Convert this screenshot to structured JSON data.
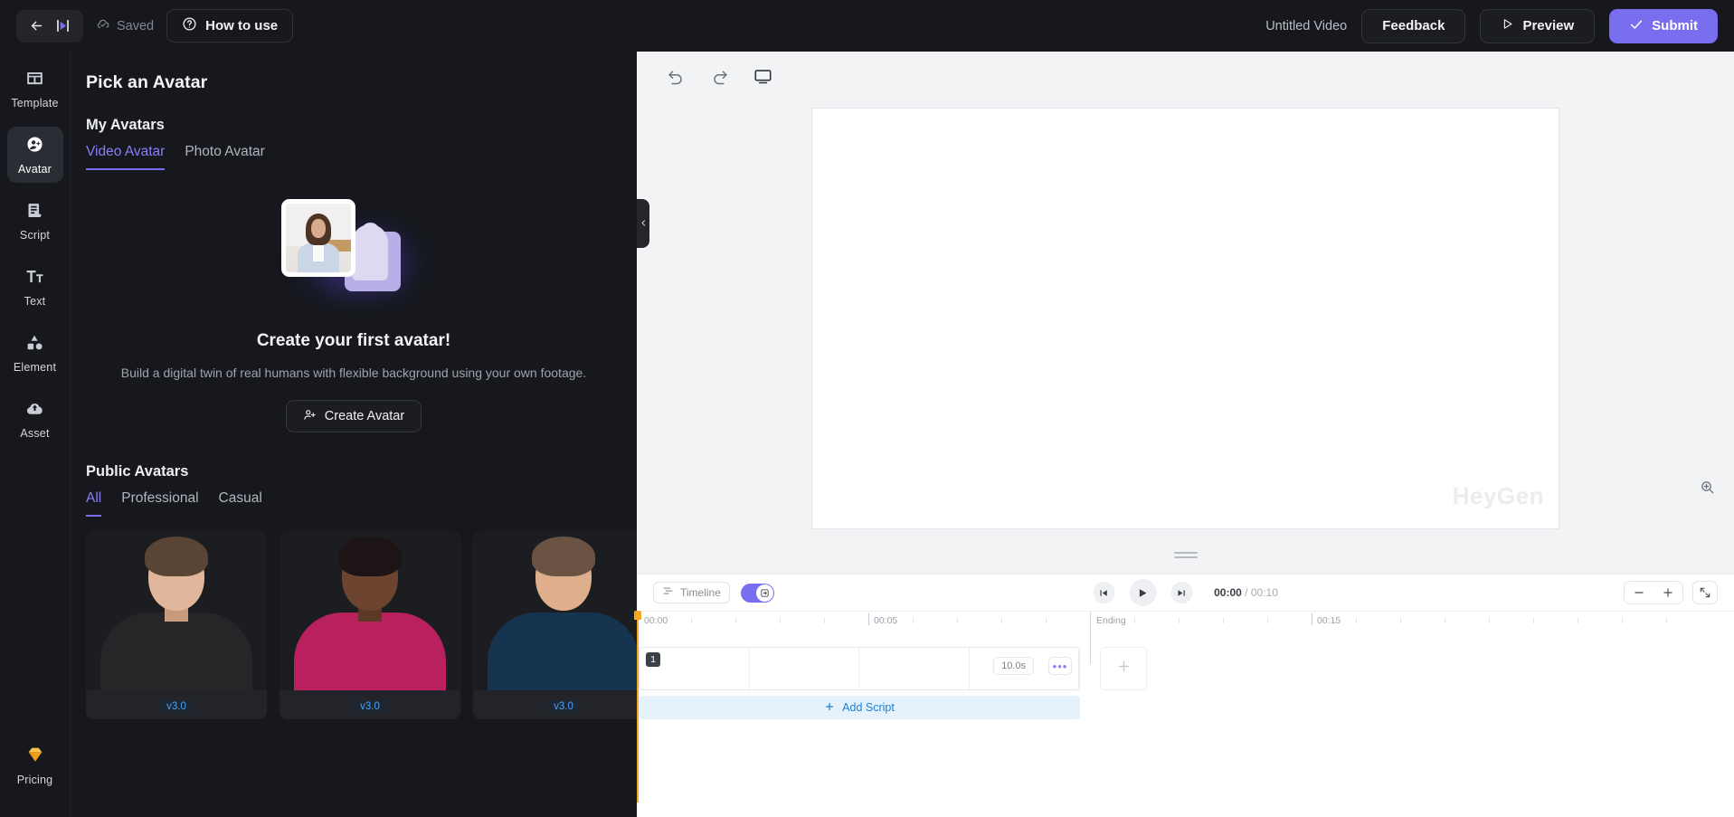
{
  "header": {
    "back_icon": "arrow-left-icon",
    "logo_icon": "heygen-logo-icon",
    "saved_label": "Saved",
    "saved_icon": "cloud-check-icon",
    "how_to_use_label": "How to use",
    "help_icon": "question-circle-icon",
    "project_title": "Untitled Video",
    "feedback_label": "Feedback",
    "preview_label": "Preview",
    "preview_icon": "play-icon",
    "submit_label": "Submit",
    "submit_icon": "check-icon",
    "accent_color": "#7a6ef0"
  },
  "rail": {
    "items": [
      {
        "label": "Template",
        "icon": "layout-template-icon",
        "active": false
      },
      {
        "label": "Avatar",
        "icon": "avatar-sparkle-icon",
        "active": true
      },
      {
        "label": "Script",
        "icon": "script-document-icon",
        "active": false
      },
      {
        "label": "Text",
        "icon": "text-tt-icon",
        "active": false
      },
      {
        "label": "Element",
        "icon": "shapes-icon",
        "active": false
      },
      {
        "label": "Asset",
        "icon": "cloud-upload-icon",
        "active": false
      }
    ],
    "pricing": {
      "label": "Pricing",
      "icon": "diamond-icon"
    }
  },
  "panel": {
    "title": "Pick an Avatar",
    "my_avatars": {
      "heading": "My Avatars",
      "tabs": [
        {
          "label": "Video Avatar",
          "active": true
        },
        {
          "label": "Photo Avatar",
          "active": false
        }
      ],
      "empty_heading": "Create your first avatar!",
      "empty_body": "Build a digital twin of real humans with flexible background using your own footage.",
      "create_button": "Create Avatar",
      "create_icon": "user-plus-icon",
      "illustration_icon": "avatar-photo-illustration"
    },
    "public_avatars": {
      "heading": "Public Avatars",
      "filters": [
        {
          "label": "All",
          "active": true
        },
        {
          "label": "Professional",
          "active": false
        },
        {
          "label": "Casual",
          "active": false
        }
      ],
      "cards": [
        {
          "version": "v3.0",
          "name": "avatar-card-1",
          "hair": "#5a4436",
          "skin": "#e0b79a",
          "shirt": "#262629"
        },
        {
          "version": "v3.0",
          "name": "avatar-card-2",
          "hair": "#1c1415",
          "skin": "#6d4430",
          "shirt": "#b8215e"
        },
        {
          "version": "v3.0",
          "name": "avatar-card-3",
          "hair": "#6b5344",
          "skin": "#dfae8d",
          "shirt": "#16344f"
        }
      ]
    },
    "collapse_icon": "chevron-left-icon"
  },
  "stage": {
    "tools": [
      {
        "icon": "undo-icon",
        "name": "undo-button"
      },
      {
        "icon": "redo-icon",
        "name": "redo-button"
      },
      {
        "icon": "display-icon",
        "name": "canvas-size-button"
      }
    ],
    "watermark": "HeyGen",
    "zoom_icon": "zoom-in-icon",
    "resize_handle_icon": "drag-handle-icon"
  },
  "timeline": {
    "chip_label": "Timeline",
    "chip_icon": "timeline-icon",
    "toggle_icon": "scene-switch-icon",
    "toggle_on": true,
    "controls": [
      {
        "icon": "skip-back-icon",
        "name": "jump-to-start-button"
      },
      {
        "icon": "play-icon",
        "name": "play-button"
      },
      {
        "icon": "skip-forward-icon",
        "name": "jump-to-end-button"
      }
    ],
    "current_time": "00:00",
    "separator": "/",
    "total_time": "00:10",
    "zoom_out_icon": "minus-icon",
    "zoom_in_icon": "plus-icon",
    "fit_icon": "collapse-arrows-icon",
    "ruler": {
      "labels": [
        "00:00",
        "00:05",
        "Ending",
        "00:15"
      ],
      "label_positions": [
        2,
        248,
        500,
        746
      ]
    },
    "scene": {
      "number": "1",
      "duration": "10.0s",
      "more_icon": "ellipsis-icon"
    },
    "add_script_label": "Add Script",
    "add_script_icon": "plus-icon",
    "add_scene_icon": "plus-icon",
    "playhead_color": "#f5a623"
  }
}
